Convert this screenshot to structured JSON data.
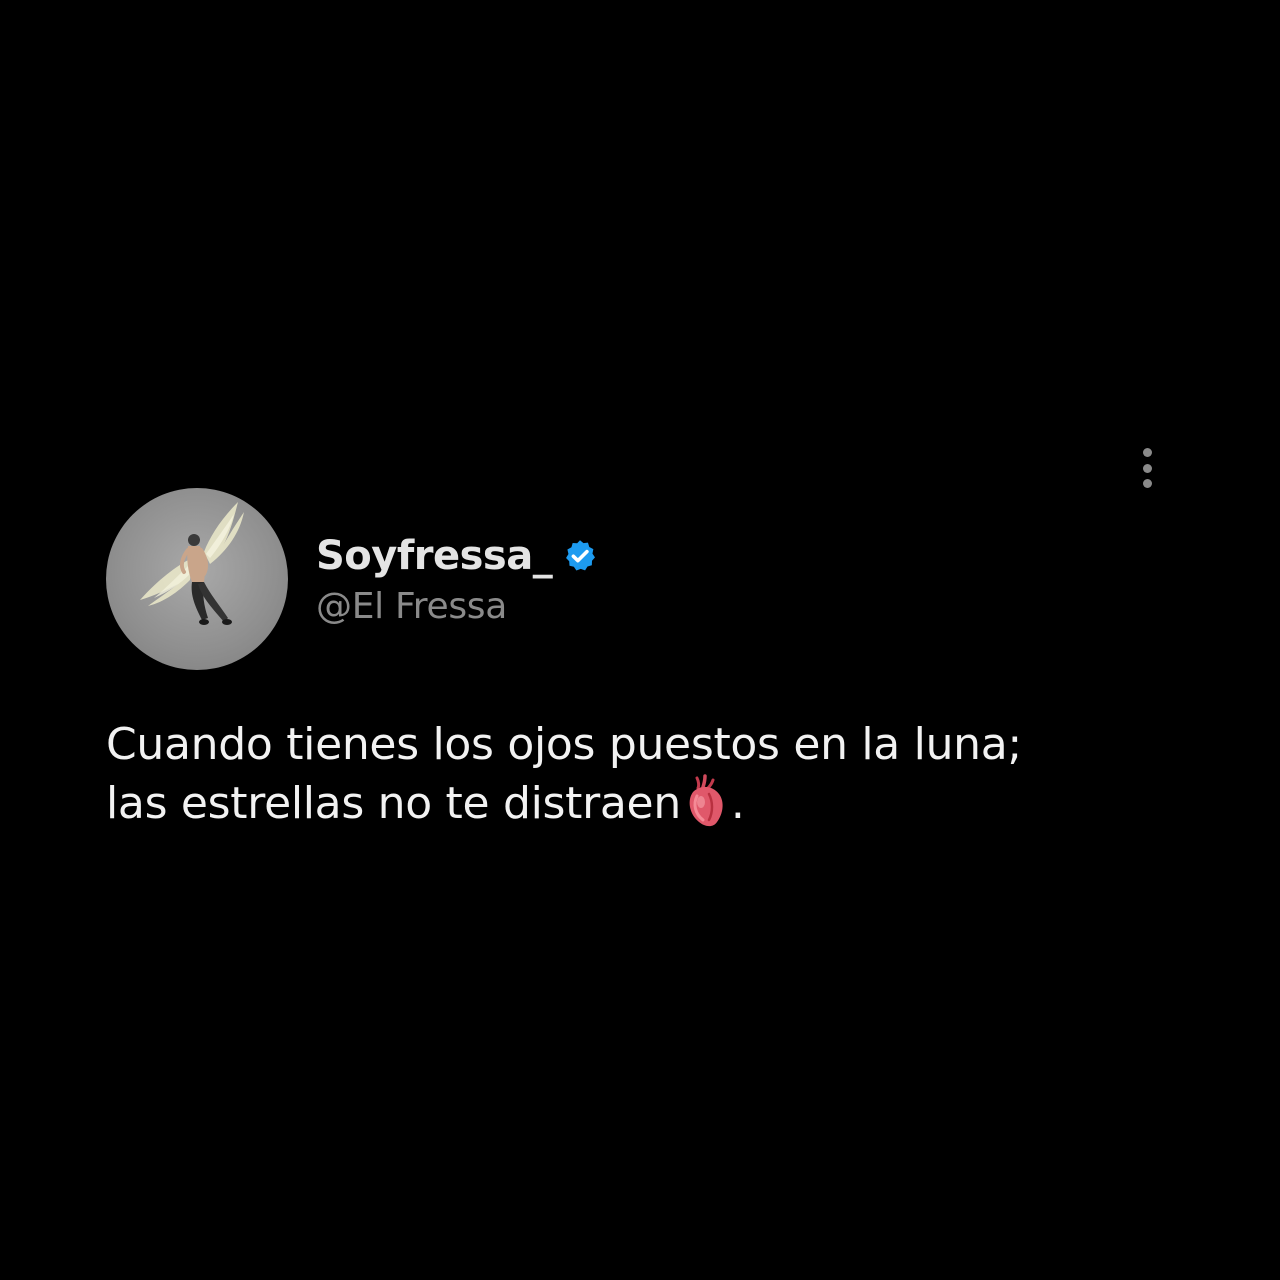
{
  "post": {
    "display_name": "Soyfressa_",
    "handle": "@El Fressa",
    "verified": true,
    "text_line_1": "Cuando tienes los ojos puestos en la luna;",
    "text_line_2_before_emoji": "las estrellas no te distraen",
    "text_line_2_after_emoji": ".",
    "emoji": "anatomical-heart-emoji"
  },
  "menu": {
    "icon": "more-vertical-icon"
  },
  "colors": {
    "background": "#000000",
    "name": "#e4e4e4",
    "handle": "#8a8a8a",
    "body_text": "#f2f2f2",
    "verified_badge": "#1d9bf0",
    "menu_dots": "#8a8a8a"
  }
}
